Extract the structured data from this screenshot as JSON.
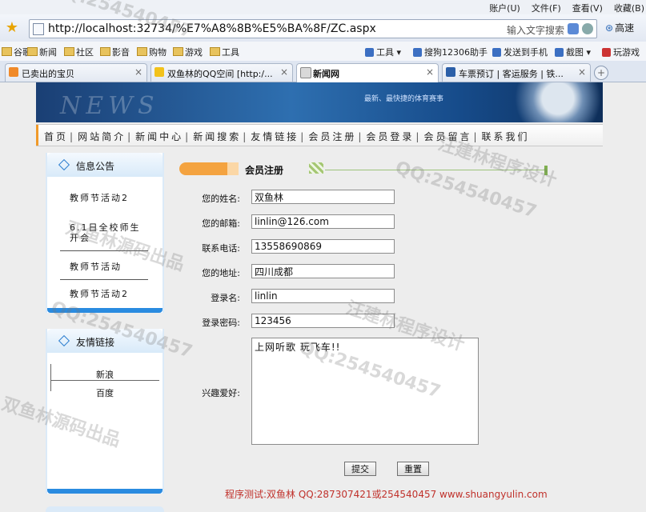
{
  "browser": {
    "menu": [
      "账户(U)",
      "文件(F)",
      "查看(V)",
      "收藏(B)"
    ],
    "url": "http://localhost:32734/%E7%A8%8B%E5%BA%8F/ZC.aspx",
    "search_placeholder": "输入文字搜索",
    "speed_label": "高速",
    "favorites": [
      "谷歌",
      "新闻",
      "社区",
      "影音",
      "购物",
      "游戏",
      "工具"
    ],
    "toolbar": [
      "工具",
      "搜狗12306助手",
      "发送到手机",
      "截图",
      "玩游戏"
    ],
    "tabs": [
      "已卖出的宝贝",
      "双鱼林的QQ空间 [http:/...",
      "新闻网",
      "车票预订 | 客运服务 | 铁..."
    ]
  },
  "banner": {
    "word": "NEWS",
    "tagline": "最新、最快捷的体育赛事"
  },
  "nav": [
    "首页",
    "网站简介",
    "新闻中心",
    "新闻搜索",
    "友情链接",
    "会员注册",
    "会员登录",
    "会员留言",
    "联系我们"
  ],
  "sidebar": {
    "notice_title": "信息公告",
    "notices": [
      "教师节活动2",
      "6.1日全校师生开会",
      "教师节活动",
      "教师节活动2"
    ],
    "links_title": "友情链接",
    "links": [
      "新浪",
      "百度"
    ]
  },
  "form": {
    "section_title": "会员注册",
    "fields": [
      {
        "label": "您的姓名:",
        "value": "双鱼林"
      },
      {
        "label": "您的邮箱:",
        "value": "linlin@126.com"
      },
      {
        "label": "联系电话:",
        "value": "13558690869"
      },
      {
        "label": "您的地址:",
        "value": "四川成都"
      },
      {
        "label": "登录名:",
        "value": "linlin"
      },
      {
        "label": "登录密码:",
        "value": "123456"
      }
    ],
    "hobby_label": "兴趣爱好:",
    "hobby_value": "上网听歌 玩飞车!!",
    "submit_label": "提交",
    "reset_label": "重置"
  },
  "footer": "程序测试:双鱼林 QQ:287307421或254540457 www.shuangyulin.com",
  "watermarks": [
    "QQ:254540457",
    "汪建林程序设计",
    "双鱼林源码出品"
  ]
}
